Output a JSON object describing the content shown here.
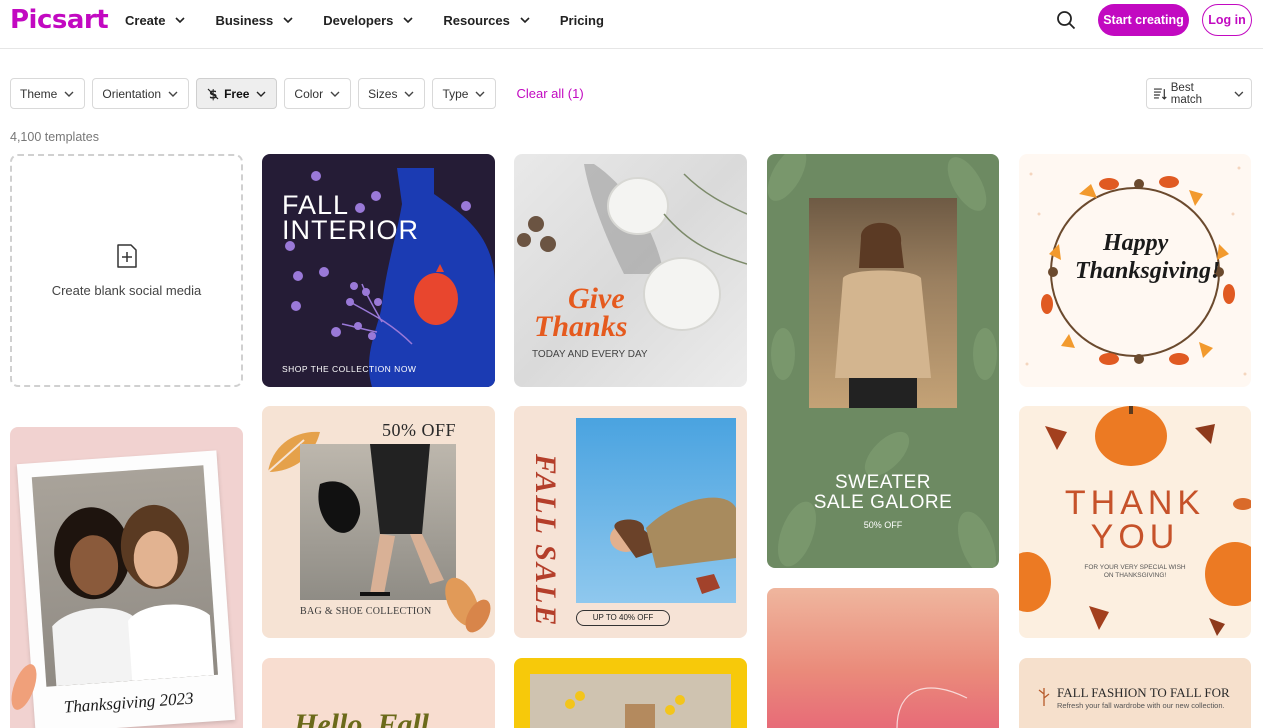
{
  "header": {
    "logo": "Picsart",
    "nav": [
      "Create",
      "Business",
      "Developers",
      "Resources",
      "Pricing"
    ],
    "start_label": "Start creating",
    "login_label": "Log in"
  },
  "filters": {
    "items": [
      "Theme",
      "Orientation",
      "Free",
      "Color",
      "Sizes",
      "Type"
    ],
    "clear_label": "Clear all (1)",
    "sort_label": "Best match"
  },
  "results": {
    "count": "4,100 templates"
  },
  "blank_card": {
    "label": "Create blank social media"
  },
  "templates": {
    "fall_interior": {
      "title_1": "FALL",
      "title_2": "INTERIOR",
      "footer": "SHOP THE COLLECTION NOW"
    },
    "give_thanks": {
      "title_1": "Give",
      "title_2": "Thanks",
      "sub": "TODAY AND EVERY DAY"
    },
    "sweater": {
      "title_1": "SWEATER",
      "title_2": "SALE GALORE",
      "sub": "50% OFF"
    },
    "thanksgiving_wreath": {
      "title_1": "Happy",
      "title_2": "Thanksgiving!"
    },
    "thanksgiving_2023": {
      "caption": "Thanksgiving 2023"
    },
    "bag_shoe": {
      "discount": "50% OFF",
      "caption": "BAG & SHOE COLLECTION"
    },
    "fall_sale": {
      "vertical": "FALL SALE",
      "badge": "UP TO 40% OFF"
    },
    "thank_you": {
      "title_1": "THANK",
      "title_2": "YOU",
      "sub_1": "FOR YOUR VERY SPECIAL WISH",
      "sub_2": "ON THANKSGIVING!"
    },
    "hello_fall": {
      "title": "Hello, Fall"
    },
    "fall_fashion": {
      "title": "FALL FASHION TO FALL FOR",
      "sub": "Refresh your fall wardrobe with our new collection."
    }
  },
  "colors": {
    "brand": "#c209c1"
  }
}
